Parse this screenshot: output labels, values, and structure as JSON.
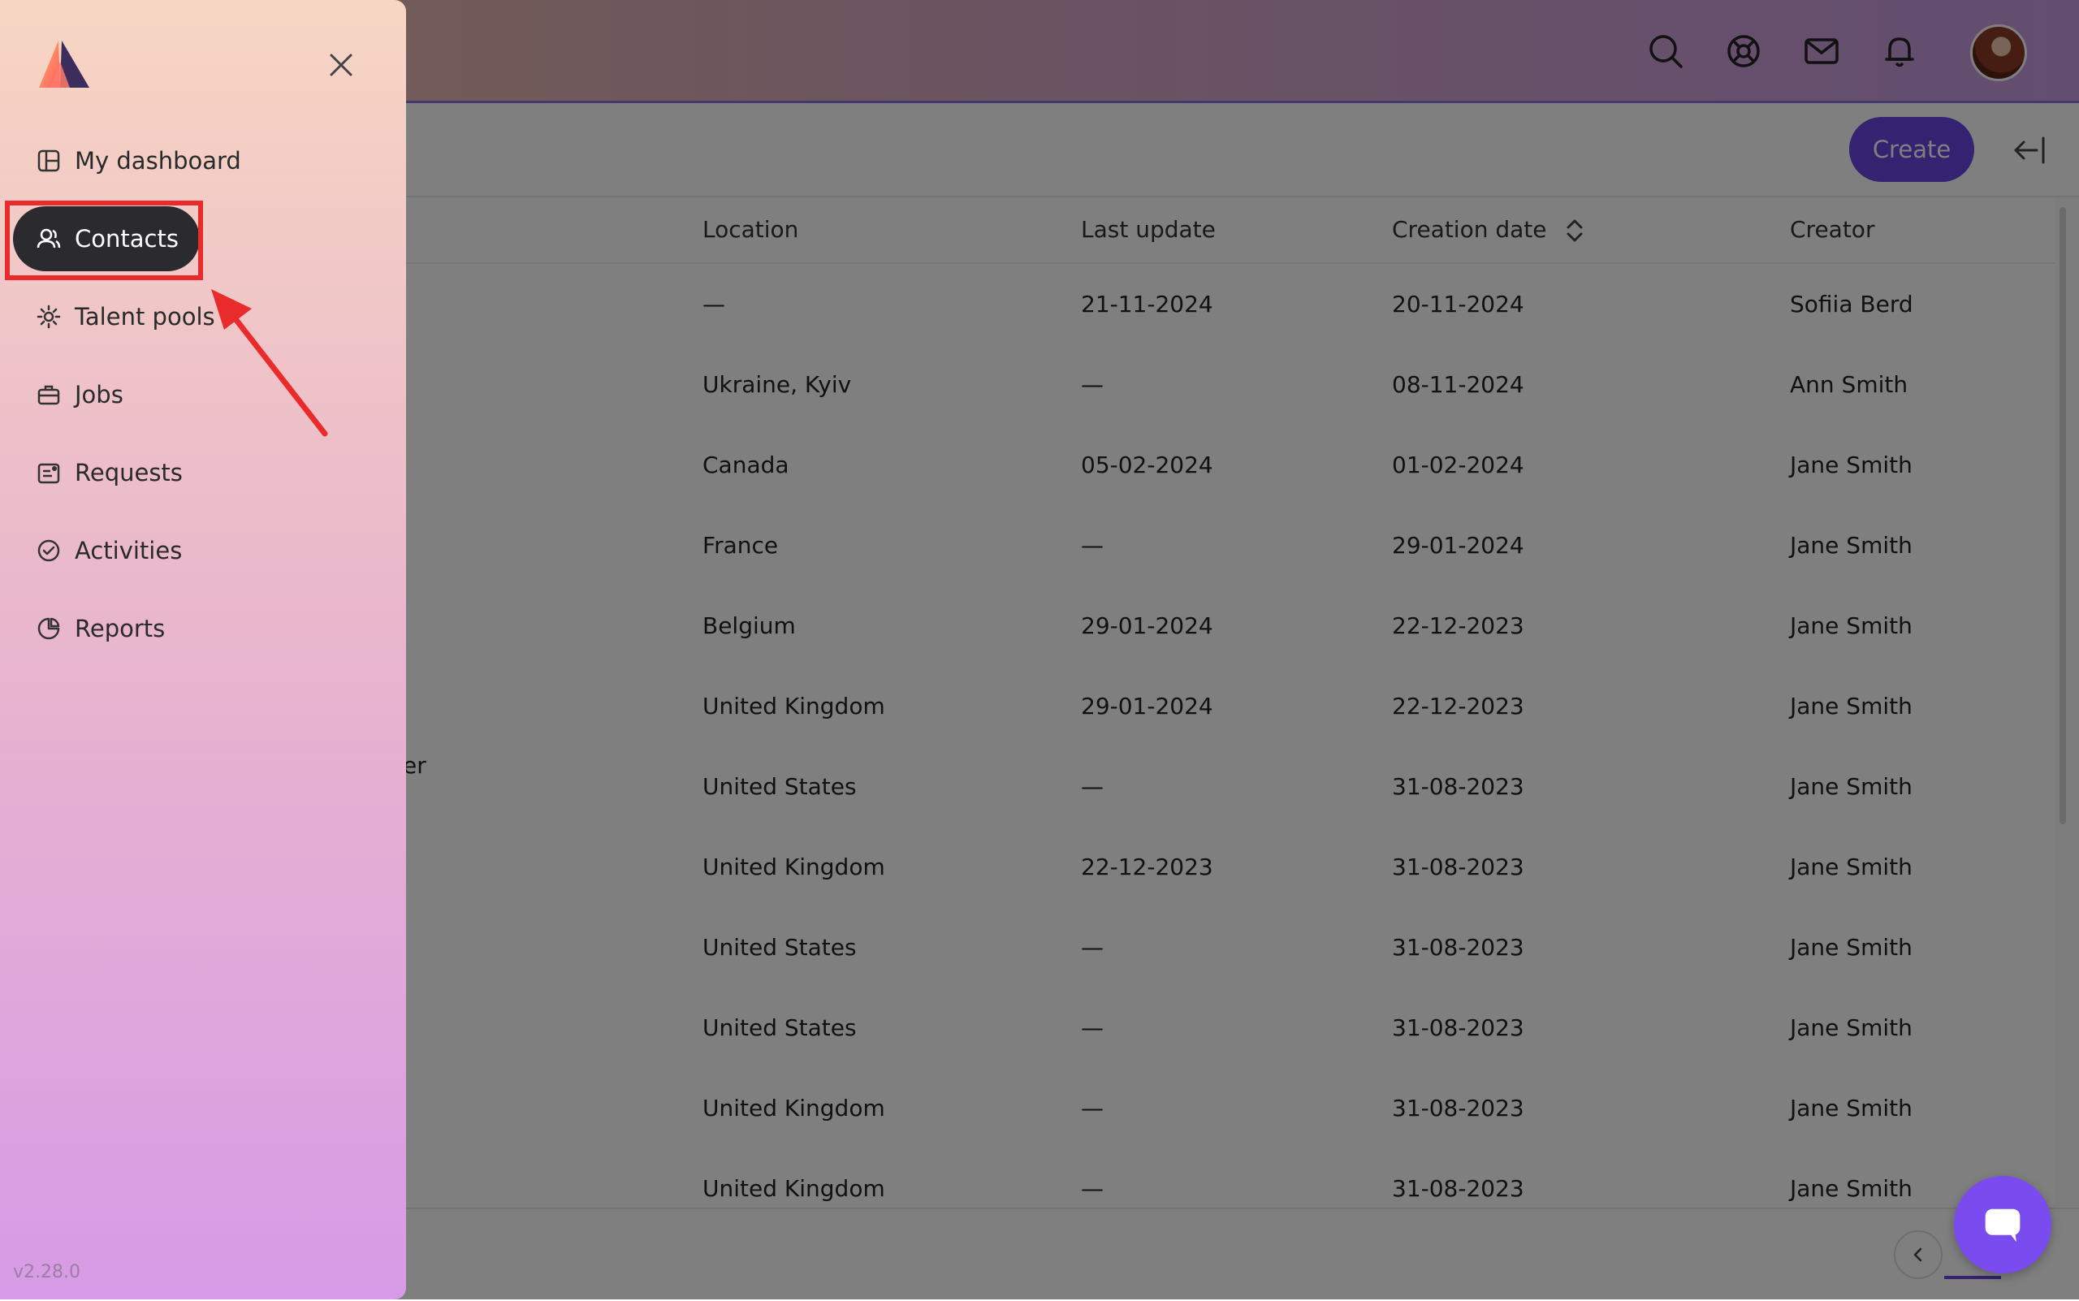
{
  "sidebar": {
    "version": "v2.28.0",
    "items": [
      {
        "label": "My dashboard",
        "icon": "dashboard-icon"
      },
      {
        "label": "Contacts",
        "icon": "contacts-icon",
        "active": true
      },
      {
        "label": "Talent pools",
        "icon": "talent-pools-icon"
      },
      {
        "label": "Jobs",
        "icon": "briefcase-icon"
      },
      {
        "label": "Requests",
        "icon": "requests-icon"
      },
      {
        "label": "Activities",
        "icon": "activities-icon"
      },
      {
        "label": "Reports",
        "icon": "reports-icon"
      }
    ]
  },
  "topbar": {
    "icons": [
      "search-icon",
      "help-lifebuoy-icon",
      "mail-icon",
      "bell-icon"
    ]
  },
  "toolbar": {
    "create_label": "Create"
  },
  "table": {
    "columns": [
      "Location",
      "Last update",
      "Creation date",
      "Creator"
    ],
    "rows": [
      {
        "location": "—",
        "last_update": "21-11-2024",
        "creation_date": "20-11-2024",
        "creator": "Sofiia Berd"
      },
      {
        "location": "Ukraine, Kyiv",
        "last_update": "—",
        "creation_date": "08-11-2024",
        "creator": "Ann Smith"
      },
      {
        "location": "Canada",
        "last_update": "05-02-2024",
        "creation_date": "01-02-2024",
        "creator": "Jane Smith"
      },
      {
        "location": "France",
        "last_update": "—",
        "creation_date": "29-01-2024",
        "creator": "Jane Smith"
      },
      {
        "location": "Belgium",
        "last_update": "29-01-2024",
        "creation_date": "22-12-2023",
        "creator": "Jane Smith"
      },
      {
        "location": "United Kingdom",
        "last_update": "29-01-2024",
        "creation_date": "22-12-2023",
        "creator": "Jane Smith"
      },
      {
        "location": "United States",
        "last_update": "—",
        "creation_date": "31-08-2023",
        "creator": "Jane Smith",
        "partial": "er"
      },
      {
        "location": "United Kingdom",
        "last_update": "22-12-2023",
        "creation_date": "31-08-2023",
        "creator": "Jane Smith"
      },
      {
        "location": "United States",
        "last_update": "—",
        "creation_date": "31-08-2023",
        "creator": "Jane Smith"
      },
      {
        "location": "United States",
        "last_update": "—",
        "creation_date": "31-08-2023",
        "creator": "Jane Smith"
      },
      {
        "location": "United Kingdom",
        "last_update": "—",
        "creation_date": "31-08-2023",
        "creator": "Jane Smith"
      },
      {
        "location": "United Kingdom",
        "last_update": "—",
        "creation_date": "31-08-2023",
        "creator": "Jane Smith"
      }
    ]
  },
  "colors": {
    "accent": "#6a44e0",
    "annotation": "#ea2b2b",
    "active_nav": "#2b2a2e"
  }
}
